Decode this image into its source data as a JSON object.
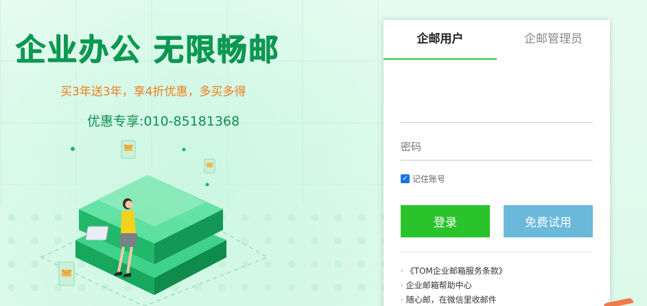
{
  "hero": {
    "headline": "企业办公 无限畅邮",
    "promo": "买3年送3年，享4折优惠，多买多得",
    "hotline": "优惠专享:010-85181368"
  },
  "login": {
    "tabs": [
      {
        "label": "企邮用户",
        "active": true
      },
      {
        "label": "企邮管理员",
        "active": false
      }
    ],
    "account_placeholder": "",
    "password_placeholder": "密码",
    "remember_label": "记住账号",
    "remember_checked": true,
    "login_button": "登录",
    "trial_button": "免费试用",
    "links": [
      "《TOM企业邮箱服务条款》",
      "企业邮箱帮助中心",
      "随心邮，在微信里收邮件"
    ]
  },
  "colors": {
    "brand_green": "#0a9a52",
    "promo_orange": "#f07d1a",
    "login_green": "#2bc32b",
    "trial_blue": "#6bb9da",
    "tab_underline": "#2bbb3e"
  }
}
